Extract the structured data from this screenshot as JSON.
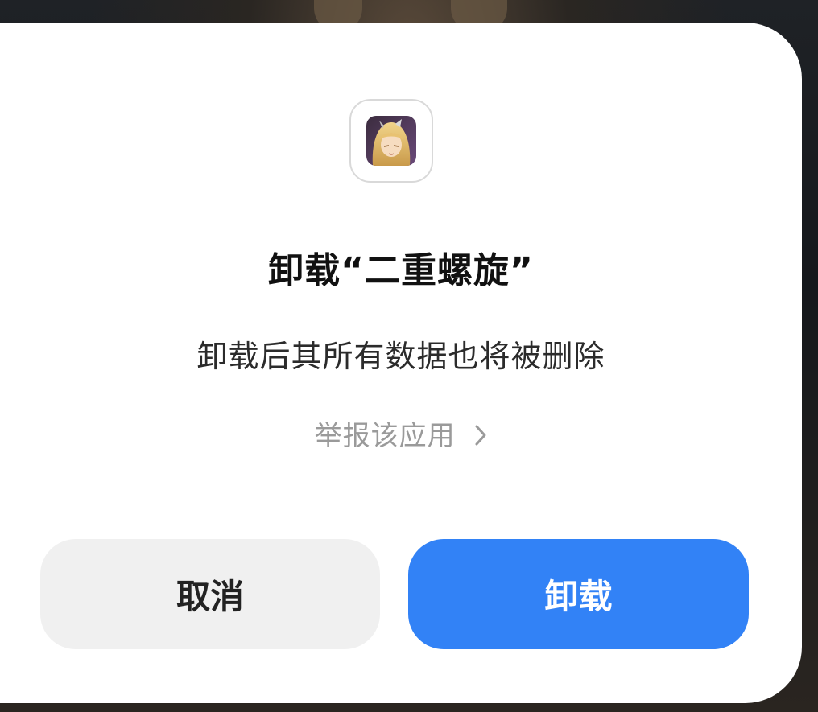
{
  "dialog": {
    "title": "卸载“二重螺旋”",
    "message": "卸载后其所有数据也将被删除",
    "report_link": "举报该应用",
    "report_link_icon": "chevron-right-icon",
    "app_icon": "app-icon-duet-night-abyss",
    "cancel_label": "取消",
    "confirm_label": "卸载"
  },
  "colors": {
    "confirm_button": "#3282f6",
    "cancel_button": "#f0f0f0",
    "dialog_background": "#ffffff",
    "link_text": "#9a9a9a"
  }
}
